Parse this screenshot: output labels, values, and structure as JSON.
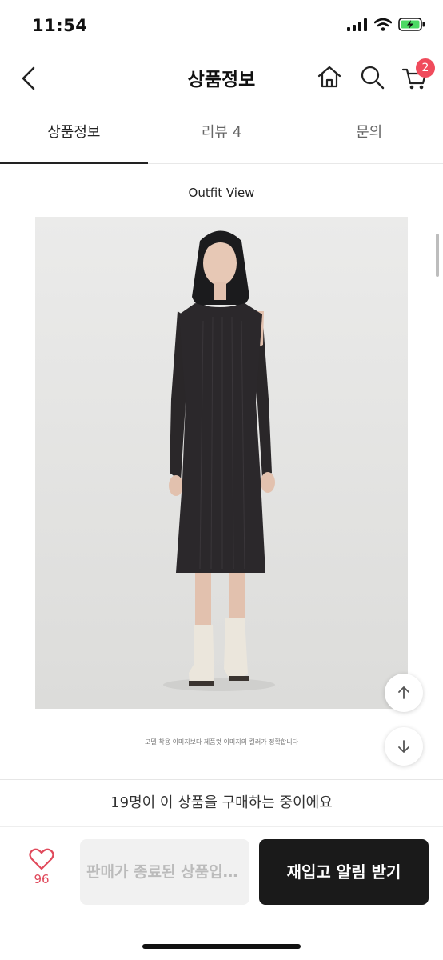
{
  "status_bar": {
    "time": "11:54"
  },
  "header": {
    "title": "상품정보",
    "cart_badge": "2"
  },
  "tabs": [
    {
      "label": "상품정보",
      "active": true
    },
    {
      "label": "리뷰 4",
      "active": false
    },
    {
      "label": "문의",
      "active": false
    }
  ],
  "content": {
    "section_title": "Outfit View",
    "caption": "모델 착용 이미지보다 제품컷 이미지의 컬러가 정확합니다"
  },
  "banner": {
    "text": "19명이 이 상품을 구매하는 중이에요"
  },
  "bottom_bar": {
    "like_count": "96",
    "soldout_label": "판매가 종료된 상품입니다",
    "restock_label": "재입고 알림 받기"
  },
  "colors": {
    "accent": "#f04b5c",
    "primary_button": "#1a1a1a",
    "like": "#e0495b"
  }
}
